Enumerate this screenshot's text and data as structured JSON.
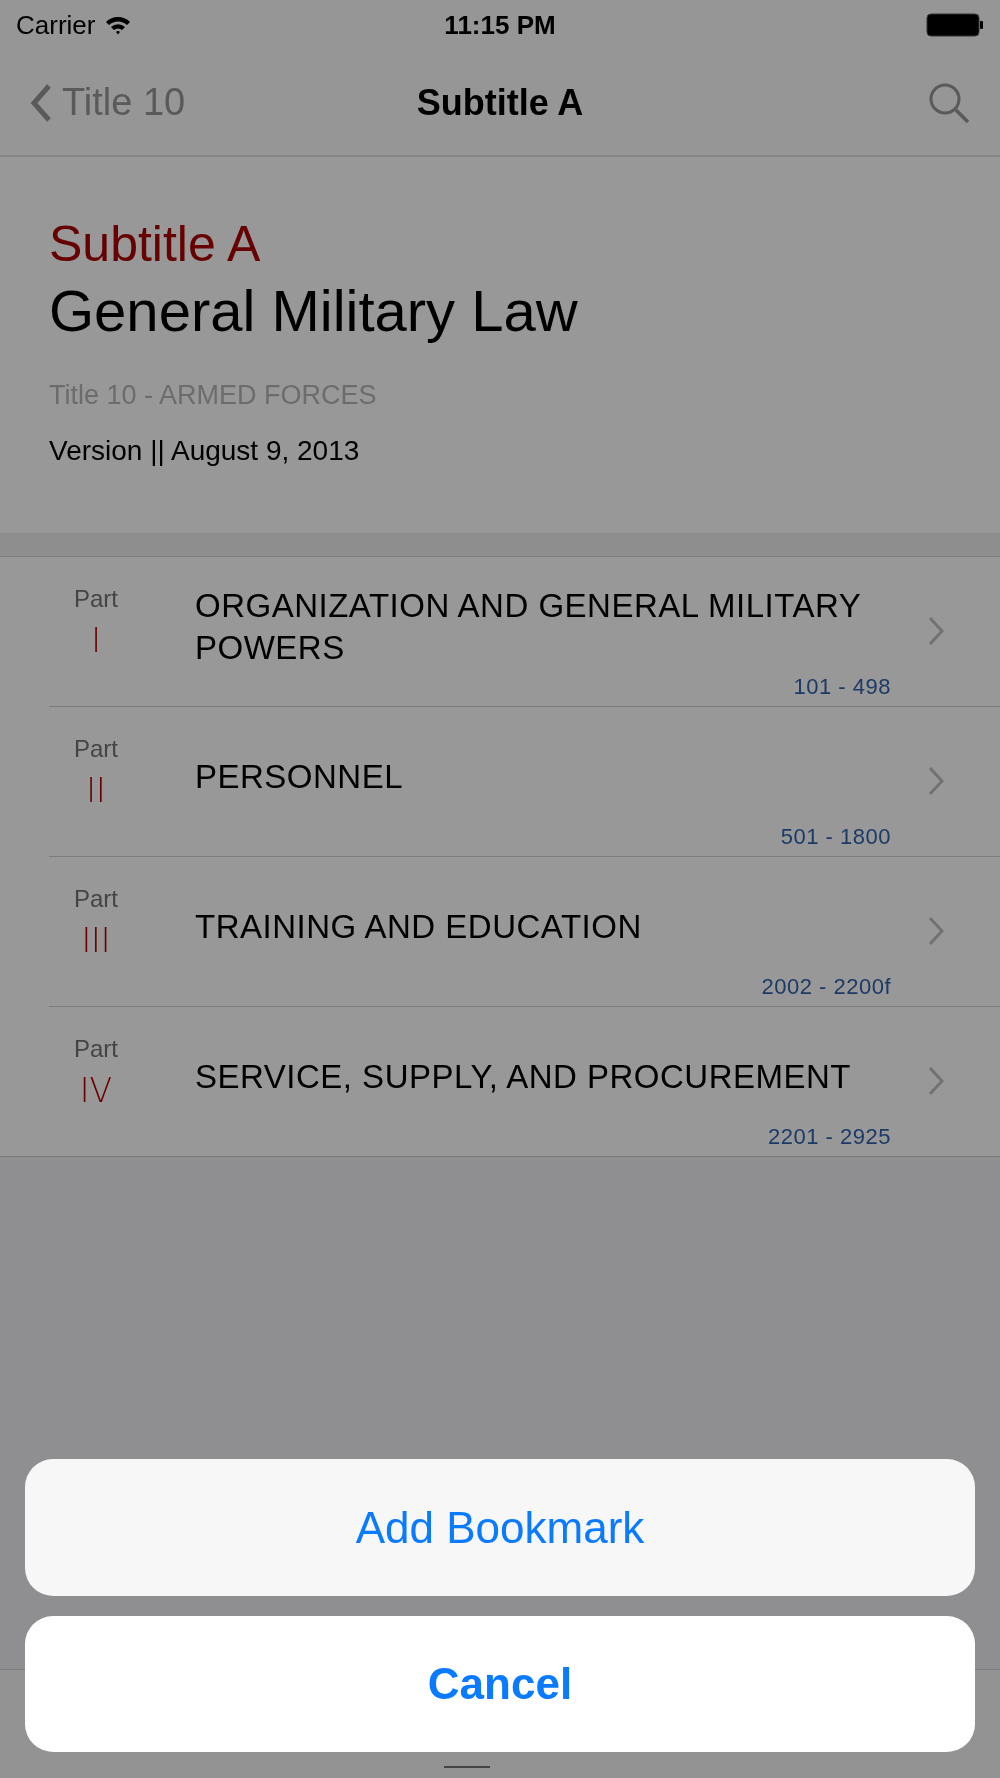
{
  "status_bar": {
    "carrier": "Carrier",
    "time": "11:15 PM"
  },
  "nav": {
    "back": "Title 10",
    "title": "Subtitle A"
  },
  "header": {
    "subtitle": "Subtitle A",
    "title": "General Military Law",
    "parent": "Title 10 - ARMED FORCES",
    "version": "Version || August 9, 2013"
  },
  "parts": [
    {
      "label": "Part",
      "numeral": "I",
      "title": "ORGANIZATION AND GENERAL MILITARY POWERS",
      "range": "101 - 498"
    },
    {
      "label": "Part",
      "numeral": "II",
      "title": "PERSONNEL",
      "range": "501 - 1800"
    },
    {
      "label": "Part",
      "numeral": "III",
      "title": "TRAINING AND EDUCATION",
      "range": "2002 - 2200f"
    },
    {
      "label": "Part",
      "numeral": "IV",
      "title": "SERVICE, SUPPLY, AND PROCUREMENT",
      "range": "2201 - 2925"
    }
  ],
  "action_sheet": {
    "actions": [
      "Add Bookmark"
    ],
    "cancel": "Cancel"
  }
}
